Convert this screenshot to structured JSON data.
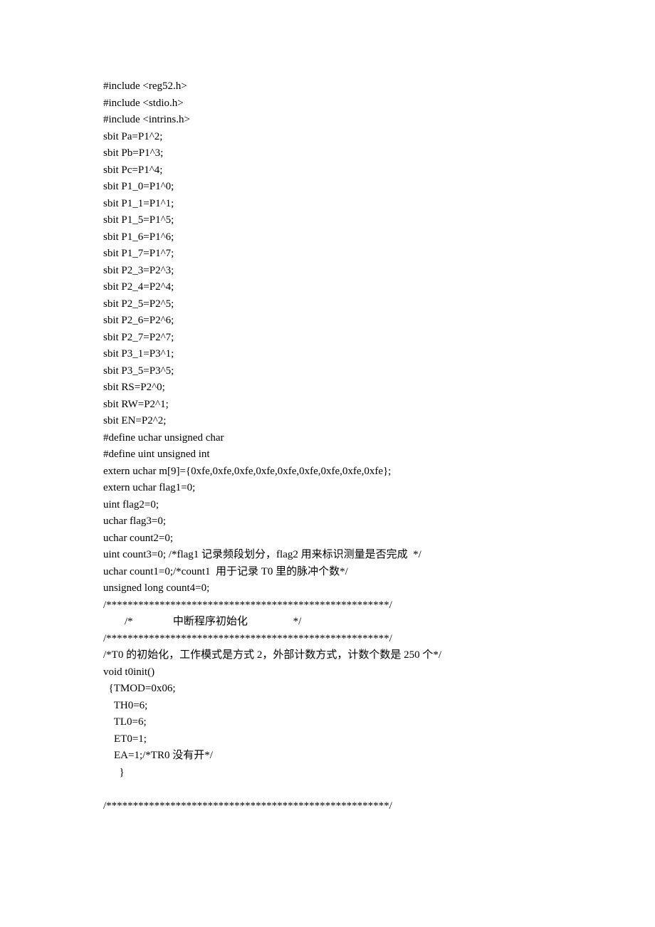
{
  "lines": [
    "#include <reg52.h>",
    "#include <stdio.h>",
    "#include <intrins.h>",
    "sbit Pa=P1^2;",
    "sbit Pb=P1^3;",
    "sbit Pc=P1^4;",
    "sbit P1_0=P1^0;",
    "sbit P1_1=P1^1;",
    "sbit P1_5=P1^5;",
    "sbit P1_6=P1^6;",
    "sbit P1_7=P1^7;",
    "sbit P2_3=P2^3;",
    "sbit P2_4=P2^4;",
    "sbit P2_5=P2^5;",
    "sbit P2_6=P2^6;",
    "sbit P2_7=P2^7;",
    "sbit P3_1=P3^1;",
    "sbit P3_5=P3^5;",
    "sbit RS=P2^0;",
    "sbit RW=P2^1;",
    "sbit EN=P2^2;",
    "#define uchar unsigned char",
    "#define uint unsigned int",
    "extern uchar m[9]={0xfe,0xfe,0xfe,0xfe,0xfe,0xfe,0xfe,0xfe,0xfe};",
    "extern uchar flag1=0;",
    "uint flag2=0;",
    "uchar flag3=0;",
    "uchar count2=0;",
    "uint count3=0; /*flag1 记录频段划分，flag2 用来标识测量是否完成  */",
    "uchar count1=0;/*count1  用于记录 T0 里的脉冲个数*/",
    "unsigned long count4=0;",
    "/*****************************************************/",
    "        /*               中断程序初始化                 */",
    "/*****************************************************/",
    "/*T0 的初始化，工作模式是方式 2，外部计数方式，计数个数是 250 个*/",
    "void t0init()",
    "  {TMOD=0x06;",
    "    TH0=6;",
    "    TL0=6;",
    "    ET0=1;",
    "    EA=1;/*TR0 没有开*/",
    "      }",
    "",
    "/*****************************************************/"
  ]
}
